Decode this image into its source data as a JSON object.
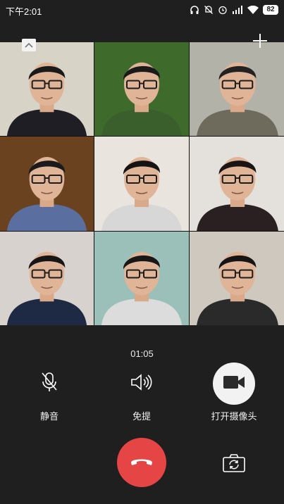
{
  "status_bar": {
    "time": "下午2:01",
    "battery": "82",
    "icons": [
      "headphones-icon",
      "bell-muted-icon",
      "alarm-icon",
      "signal-icon",
      "wifi-icon",
      "battery-icon"
    ]
  },
  "call": {
    "timer": "01:05",
    "minimize_icon": "chevron-up-icon",
    "add_icon": "plus-icon"
  },
  "participants": [
    {
      "id": 1,
      "bg": "#d8d3c7",
      "shirt": "#1e1e24",
      "hair": "#1a1a1a"
    },
    {
      "id": 2,
      "bg": "#3e6a2c",
      "shirt": "#3a5f2c",
      "hair": "#1a1a1a"
    },
    {
      "id": 3,
      "bg": "#b2b2a8",
      "shirt": "#6e6a5c",
      "hair": "#222"
    },
    {
      "id": 4,
      "bg": "#6a4220",
      "shirt": "#5a6fa0",
      "hair": "#1b1b1b"
    },
    {
      "id": 5,
      "bg": "#e9e5de",
      "shirt": "#d7d7d7",
      "hair": "#141414"
    },
    {
      "id": 6,
      "bg": "#e4e0dc",
      "shirt": "#2a2022",
      "hair": "#1b1414"
    },
    {
      "id": 7,
      "bg": "#d7d2cd",
      "shirt": "#1e2a44",
      "hair": "#161616"
    },
    {
      "id": 8,
      "bg": "#9bc0ba",
      "shirt": "#dcdcdc",
      "hair": "#171717"
    },
    {
      "id": 9,
      "bg": "#cfc8bf",
      "shirt": "#2a2a2a",
      "hair": "#151515"
    }
  ],
  "controls": {
    "mute": {
      "label": "静音",
      "icon": "microphone-off-icon"
    },
    "speaker": {
      "label": "免提",
      "icon": "speaker-icon"
    },
    "camera": {
      "label": "打开摄像头",
      "icon": "video-camera-icon"
    },
    "hangup_icon": "phone-hangup-icon",
    "switch_camera_icon": "switch-camera-icon"
  },
  "colors": {
    "background": "#1f1f1f",
    "hangup": "#e64545",
    "camera_button": "#f2f2f2"
  }
}
